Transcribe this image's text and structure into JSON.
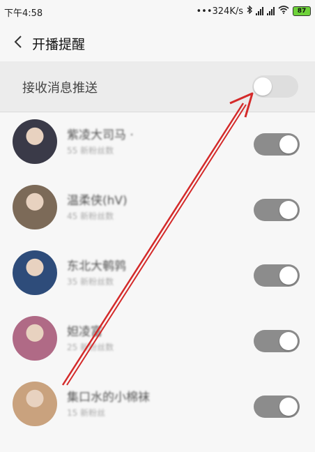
{
  "status_bar": {
    "time": "下午4:58",
    "speed": "•••324K/s",
    "battery": "87"
  },
  "header": {
    "title": "开播提醒"
  },
  "push_setting": {
    "label": "接收消息推送",
    "enabled": false
  },
  "streamers": [
    {
      "name": "紫凌大司马 ·",
      "sub": "55 新粉丝数",
      "enabled": true,
      "avatar_color": "#3a3a48"
    },
    {
      "name": "温柔侠(hV)",
      "sub": "45 新粉丝数",
      "enabled": true,
      "avatar_color": "#7c6a58"
    },
    {
      "name": "东北大鹌鹑",
      "sub": "35 新粉丝数",
      "enabled": true,
      "avatar_color": "#2e4c7a"
    },
    {
      "name": "妲凌富",
      "sub": "25 新粉丝数",
      "enabled": true,
      "avatar_color": "#b06a86"
    },
    {
      "name": "集口水的小棉袜",
      "sub": "15 新粉丝",
      "enabled": true,
      "avatar_color": "#c9a27e"
    }
  ],
  "colors": {
    "arrow": "#d42a2a",
    "switch_on": "#8c8c8c",
    "switch_off": "#dedede"
  }
}
